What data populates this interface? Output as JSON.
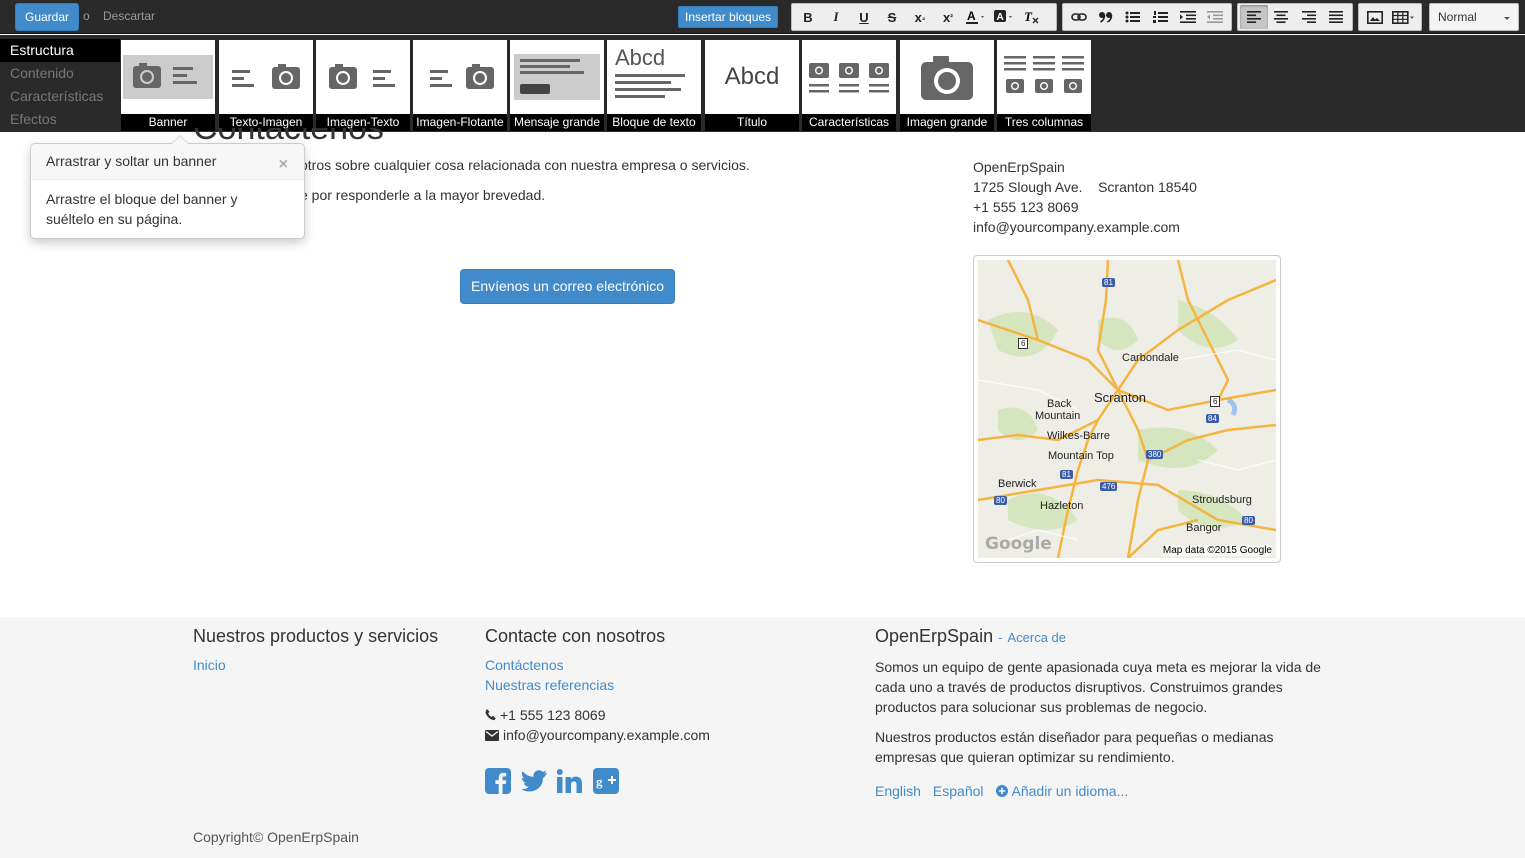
{
  "toolbar": {
    "save_label": "Guardar",
    "or_label": "o",
    "discard_label": "Descartar",
    "insert_blocks_label": "Insertar bloques",
    "format": {
      "selected": "Normal"
    },
    "buttons": [
      {
        "name": "bold-button",
        "glyph": "B"
      },
      {
        "name": "italic-button",
        "glyph": "I"
      },
      {
        "name": "underline-button",
        "glyph": "U"
      },
      {
        "name": "strike-button",
        "glyph": "S"
      },
      {
        "name": "subscript-button",
        "glyph": "x"
      },
      {
        "name": "superscript-button",
        "glyph": "x"
      }
    ]
  },
  "snippets": {
    "categories": [
      {
        "label": "Estructura",
        "active": true
      },
      {
        "label": "Contenido",
        "active": false
      },
      {
        "label": "Características",
        "active": false
      },
      {
        "label": "Efectos",
        "active": false
      }
    ],
    "items": [
      {
        "label": "Banner"
      },
      {
        "label": "Texto-Imagen"
      },
      {
        "label": "Imagen-Texto"
      },
      {
        "label": "Imagen-Flotante"
      },
      {
        "label": "Mensaje grande"
      },
      {
        "label": "Bloque de texto",
        "thumb_text": "Abcd"
      },
      {
        "label": "Título",
        "thumb_text": "Abcd"
      },
      {
        "label": "Características"
      },
      {
        "label": "Imagen grande"
      },
      {
        "label": "Tres columnas"
      }
    ]
  },
  "popover": {
    "title": "Arrastrar y soltar un banner",
    "close": "×",
    "body": "Arrastre el bloque del banner y suéltelo en su página."
  },
  "main": {
    "title_fragment": "Contáctenos",
    "para1": "otros sobre cualquier cosa relacionada con nuestra empresa o servicios.",
    "para2": "e por responderle a la mayor brevedad.",
    "email_button": "Envíenos un correo electrónico"
  },
  "contact": {
    "company": "OpenErpSpain",
    "street": "1725 Slough Ave.",
    "city": "Scranton 18540",
    "phone": "+1 555 123 8069",
    "email": "info@yourcompany.example.com"
  },
  "map": {
    "labels": [
      "Carbondale",
      "Scranton",
      "Back",
      "Mountain",
      "Wilkes-Barre",
      "Mountain Top",
      "Berwick",
      "Hazleton",
      "Stroudsburg",
      "Bangor"
    ],
    "shields": [
      "81",
      "6",
      "6",
      "84",
      "380",
      "81",
      "476",
      "80",
      "80"
    ],
    "google": "Google",
    "credit": "Map data ©2015 Google"
  },
  "footer": {
    "col1_title": "Nuestros productos y servicios",
    "col1_link": "Inicio",
    "col2_title": "Contacte con nosotros",
    "col2_link1": "Contáctenos",
    "col2_link2": "Nuestras referencias",
    "col2_phone": "+1 555 123 8069",
    "col2_email": "info@yourcompany.example.com",
    "col3_title": "OpenErpSpain",
    "col3_sep": "-",
    "col3_about": "Acerca de",
    "col3_p1": "Somos un equipo de gente apasionada cuya meta es mejorar la vida de cada uno a través de productos disruptivos. Construimos grandes productos para solucionar sus problemas de negocio.",
    "col3_p2": "Nuestros productos están diseñador para pequeñas o medianas empresas que quieran optimizar su rendimiento.",
    "lang_en": "English",
    "lang_es": "Español",
    "add_lang": "Añadir un idioma...",
    "copyright": "Copyright© OpenErpSpain"
  },
  "colors": {
    "accent": "#428bca",
    "bar": "#2a2a2a"
  }
}
